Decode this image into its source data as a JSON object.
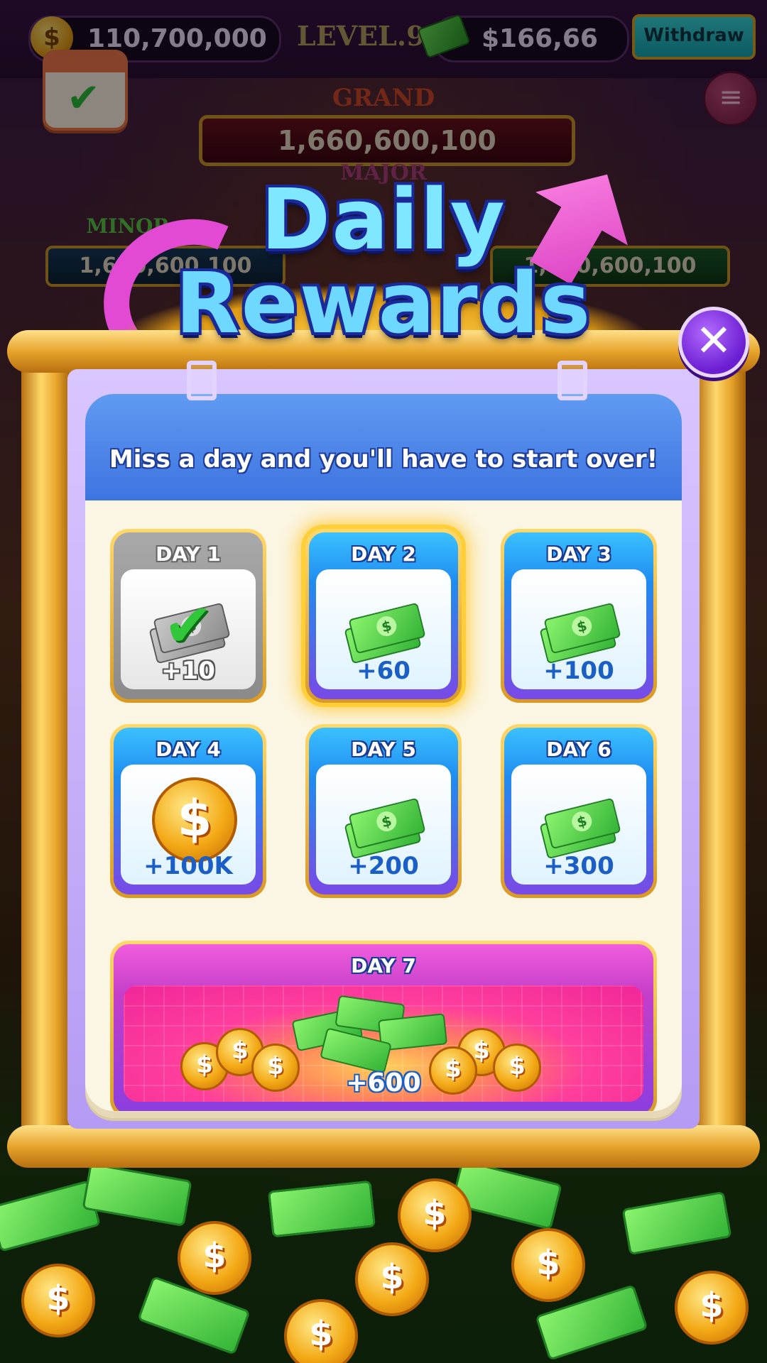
{
  "hud": {
    "coins": "110,700,000",
    "level": "LEVEL.9",
    "cash": "$166,66",
    "withdraw_label": "Withdraw",
    "coin_icon": "$",
    "menu_icon": "≡"
  },
  "jackpots": {
    "grand_label": "GRAND",
    "grand_value": "1,660,600,100",
    "major_label": "MAJOR",
    "minor_label": "MINOR",
    "minor_value": "1,660,600,100",
    "mini_value": "1,660,600,100"
  },
  "dialog": {
    "title_line1": "Daily",
    "title_line2": "Rewards",
    "close_icon": "✕",
    "subtitle": "Miss a day and you'll have to start over!",
    "days": [
      {
        "label": "DAY 1",
        "amount": "+10",
        "state": "claimed",
        "reward": "cash"
      },
      {
        "label": "DAY 2",
        "amount": "+60",
        "state": "current",
        "reward": "cash"
      },
      {
        "label": "DAY 3",
        "amount": "+100",
        "state": "locked",
        "reward": "cash"
      },
      {
        "label": "DAY 4",
        "amount": "+100K",
        "state": "locked",
        "reward": "coins"
      },
      {
        "label": "DAY 5",
        "amount": "+200",
        "state": "locked",
        "reward": "cash"
      },
      {
        "label": "DAY 6",
        "amount": "+300",
        "state": "locked",
        "reward": "cash"
      },
      {
        "label": "DAY 7",
        "amount": "+600",
        "state": "locked",
        "reward": "cash-and-coins"
      }
    ]
  },
  "icons": {
    "dollar": "$",
    "check": "✔"
  },
  "colors": {
    "accent_blue": "#3e74e0",
    "gold": "#e7a52b",
    "purple": "#6a1dd1",
    "cash_green": "#34b437"
  }
}
